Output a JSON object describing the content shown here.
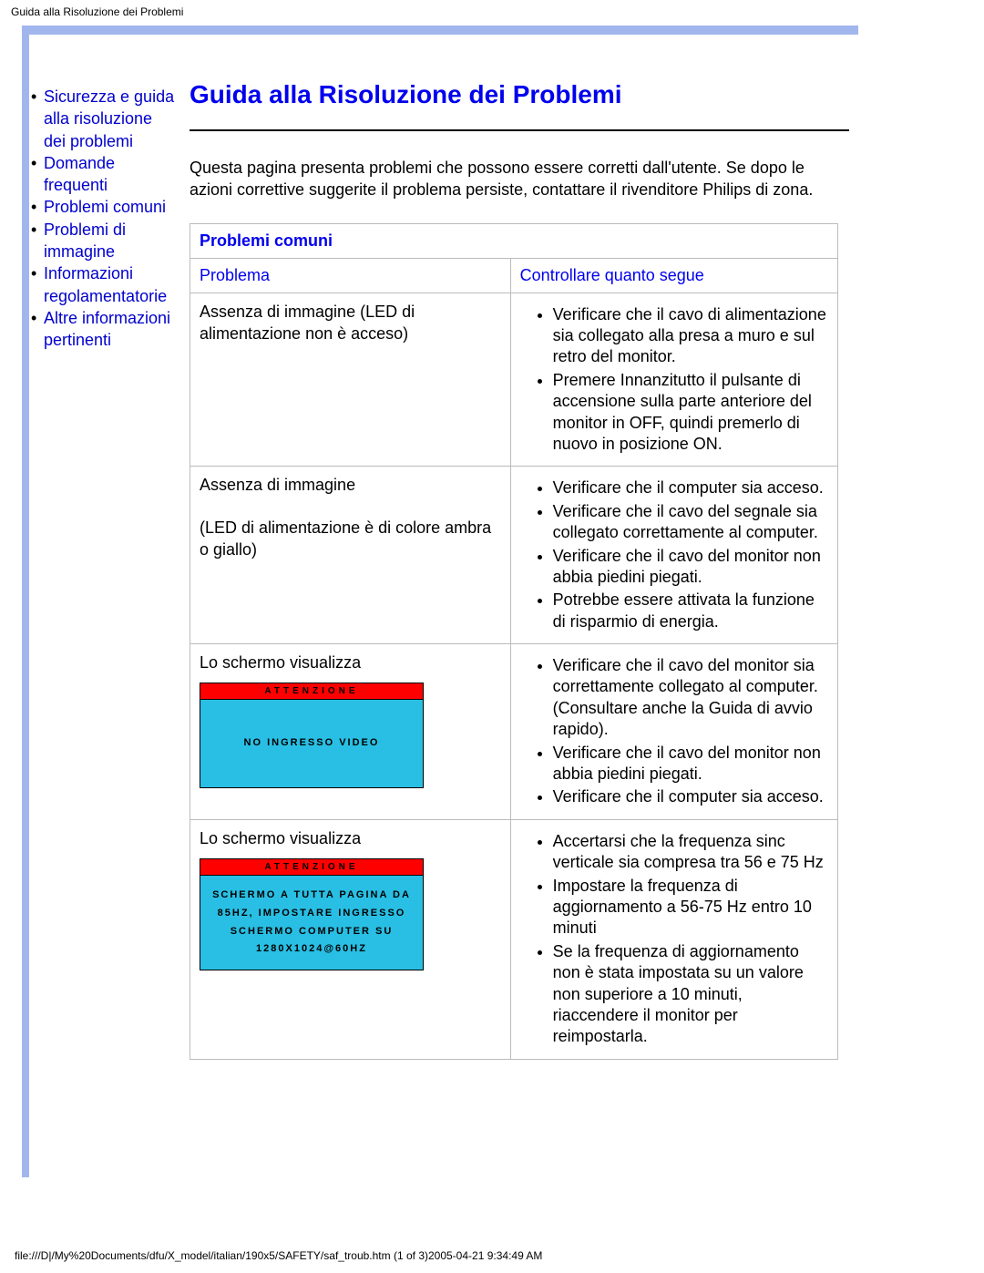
{
  "header": "Guida alla Risoluzione dei Problemi",
  "sidebar": {
    "items": [
      {
        "label": "Sicurezza e guida alla risoluzione dei problemi"
      },
      {
        "label": "Domande frequenti"
      },
      {
        "label": "Problemi comuni"
      },
      {
        "label": "Problemi di immagine"
      },
      {
        "label": "Informazioni regolamentatorie"
      },
      {
        "label": "Altre informazioni pertinenti"
      }
    ]
  },
  "main": {
    "title": "Guida alla Risoluzione dei Problemi",
    "intro": "Questa pagina presenta problemi che possono essere corretti dall'utente. Se dopo le azioni correttive suggerite il problema persiste, contattare il rivenditore Philips di zona.",
    "section_heading": "Problemi comuni",
    "col_problem": "Problema",
    "col_check": "Controllare quanto segue",
    "rows": [
      {
        "problem_line1": "Assenza di immagine (LED di alimentazione non è acceso)",
        "problem_line2": "",
        "warn_header": "",
        "warn_body": "",
        "checks": [
          "Verificare che il cavo di alimentazione sia collegato alla presa a muro e sul retro del monitor.",
          "Premere Innanzitutto il pulsante di accensione sulla parte anteriore del monitor in OFF, quindi premerlo di nuovo in posizione ON."
        ]
      },
      {
        "problem_line1": "Assenza di immagine",
        "problem_line2": "(LED di alimentazione è di colore ambra o giallo)",
        "warn_header": "",
        "warn_body": "",
        "checks": [
          "Verificare che il computer sia acceso.",
          "Verificare che il cavo del segnale sia collegato correttamente al computer.",
          "Verificare che il cavo del monitor non abbia piedini piegati.",
          "Potrebbe essere attivata la funzione di risparmio di energia."
        ]
      },
      {
        "problem_line1": "Lo schermo visualizza",
        "problem_line2": "",
        "warn_header": "ATTENZIONE",
        "warn_body": "NO INGRESSO VIDEO",
        "checks": [
          "Verificare che il cavo del monitor sia correttamente collegato al computer. (Consultare anche la Guida di avvio rapido).",
          "Verificare che il cavo del monitor non abbia piedini piegati.",
          "Verificare che il computer sia acceso."
        ]
      },
      {
        "problem_line1": "Lo schermo visualizza",
        "problem_line2": "",
        "warn_header": "ATTENZIONE",
        "warn_body": "SCHERMO A TUTTA PAGINA DA 85HZ, IMPOSTARE INGRESSO SCHERMO COMPUTER SU 1280X1024@60HZ",
        "checks": [
          "Accertarsi che la frequenza sinc verticale sia compresa tra 56 e 75 Hz",
          "Impostare la frequenza di aggiornamento a 56-75 Hz entro 10 minuti",
          "Se la frequenza di aggiornamento non è stata impostata su un valore non superiore a 10 minuti, riaccendere il monitor per reimpostarla."
        ]
      }
    ]
  },
  "footer": "file:///D|/My%20Documents/dfu/X_model/italian/190x5/SAFETY/saf_troub.htm (1 of 3)2005-04-21 9:34:49 AM"
}
